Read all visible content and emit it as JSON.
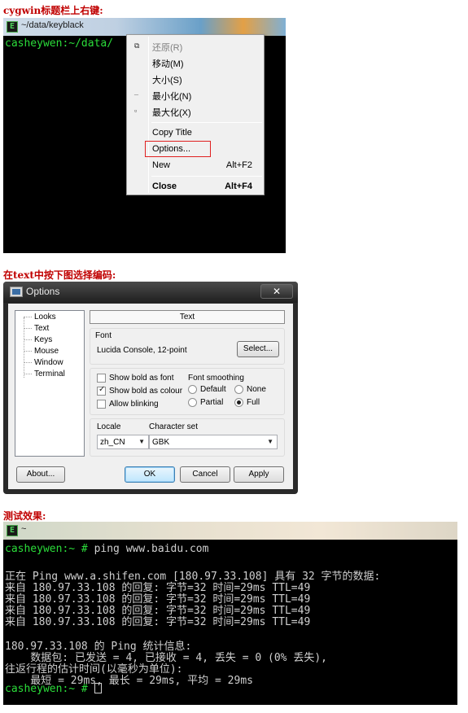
{
  "captions": {
    "step1": "cygwin标题栏上右键:",
    "step2": "在text中按下图选择编码:",
    "step3": "测试效果:"
  },
  "section1": {
    "window_title": "~/data/keyblack",
    "prompt": "casheywen:~/data/",
    "menu": [
      {
        "label": "还原(R)",
        "icon": "restore-icon",
        "disabled": true
      },
      {
        "label": "移动(M)"
      },
      {
        "label": "大小(S)"
      },
      {
        "label": "最小化(N)",
        "icon": "minimize-icon"
      },
      {
        "label": "最大化(X)",
        "icon": "maximize-icon"
      },
      {
        "label": "Copy Title"
      },
      {
        "label": "Options..."
      },
      {
        "label": "New",
        "shortcut": "Alt+F2"
      },
      {
        "label": "Close",
        "shortcut": "Alt+F4"
      }
    ]
  },
  "section2": {
    "dialog_title": "Options",
    "close_symbol": "✕",
    "tree": [
      "Looks",
      "Text",
      "Keys",
      "Mouse",
      "Window",
      "Terminal"
    ],
    "selected_page": "Text",
    "font": {
      "group_label": "Font",
      "value": "Lucida Console, 12-point",
      "select_button": "Select..."
    },
    "checkboxes": [
      {
        "label": "Show bold as font",
        "checked": false
      },
      {
        "label": "Show bold as colour",
        "checked": true
      },
      {
        "label": "Allow blinking",
        "checked": false
      }
    ],
    "smoothing": {
      "label": "Font smoothing",
      "options": [
        {
          "label": "Default",
          "checked": false
        },
        {
          "label": "None",
          "checked": false
        },
        {
          "label": "Partial",
          "checked": false
        },
        {
          "label": "Full",
          "checked": true
        }
      ]
    },
    "locale": {
      "label": "Locale",
      "value": "zh_CN"
    },
    "charset": {
      "label": "Character set",
      "value": "GBK"
    },
    "buttons": {
      "about": "About...",
      "ok": "OK",
      "cancel": "Cancel",
      "apply": "Apply"
    }
  },
  "section3": {
    "window_title": "~",
    "lines": [
      {
        "prompt": "casheywen:~ # ",
        "text": "ping www.baidu.com"
      },
      {
        "text": ""
      },
      {
        "text": "正在 Ping www.a.shifen.com [180.97.33.108] 具有 32 字节的数据:"
      },
      {
        "text": "来自 180.97.33.108 的回复: 字节=32 时间=29ms TTL=49"
      },
      {
        "text": "来自 180.97.33.108 的回复: 字节=32 时间=29ms TTL=49"
      },
      {
        "text": "来自 180.97.33.108 的回复: 字节=32 时间=29ms TTL=49"
      },
      {
        "text": "来自 180.97.33.108 的回复: 字节=32 时间=29ms TTL=49"
      },
      {
        "text": ""
      },
      {
        "text": "180.97.33.108 的 Ping 统计信息:"
      },
      {
        "text": "    数据包: 已发送 = 4, 已接收 = 4, 丢失 = 0 (0% 丢失),"
      },
      {
        "text": "往返行程的估计时间(以毫秒为单位):"
      },
      {
        "text": "    最短 = 29ms, 最长 = 29ms, 平均 = 29ms"
      },
      {
        "prompt": "casheywen:~ # ",
        "text": ""
      }
    ]
  }
}
